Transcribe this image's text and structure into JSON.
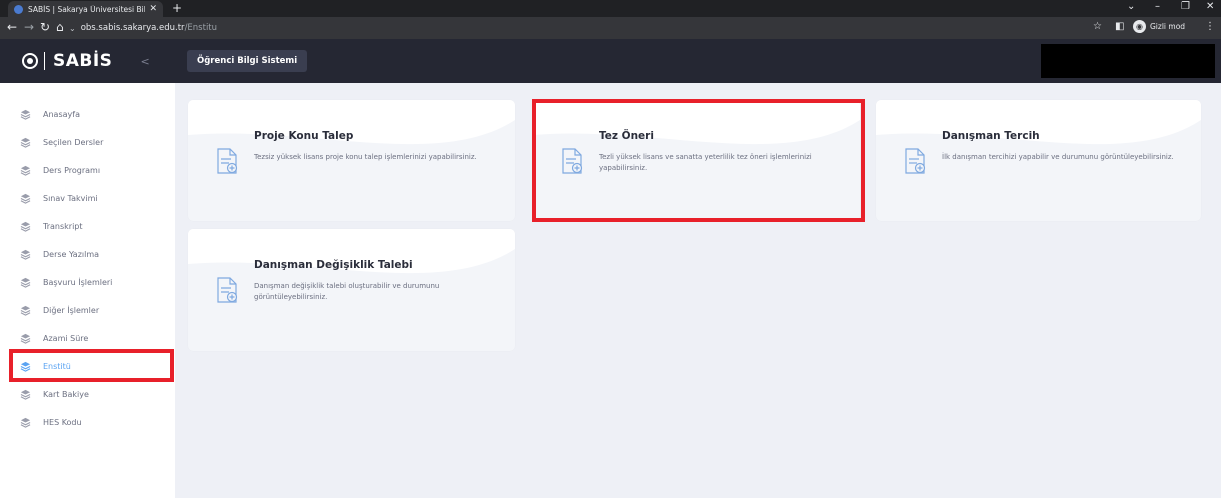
{
  "browser": {
    "tab_title": "SABİS | Sakarya Üniversitesi Bilgi",
    "url_host": "obs.sabis.sakarya.edu.tr",
    "url_path": "/Enstitu",
    "incognito_label": "Gizli mod"
  },
  "header": {
    "brand": "SABİS",
    "system_button": "Öğrenci Bilgi Sistemi"
  },
  "sidebar": {
    "items": [
      {
        "label": "Anasayfa",
        "active": false
      },
      {
        "label": "Seçilen Dersler",
        "active": false
      },
      {
        "label": "Ders Programı",
        "active": false
      },
      {
        "label": "Sınav Takvimi",
        "active": false
      },
      {
        "label": "Transkript",
        "active": false
      },
      {
        "label": "Derse Yazılma",
        "active": false
      },
      {
        "label": "Başvuru İşlemleri",
        "active": false
      },
      {
        "label": "Diğer İşlemler",
        "active": false
      },
      {
        "label": "Azami Süre",
        "active": false
      },
      {
        "label": "Enstitü",
        "active": true
      },
      {
        "label": "Kart Bakiye",
        "active": false
      },
      {
        "label": "HES Kodu",
        "active": false
      }
    ]
  },
  "cards": [
    {
      "title": "Proje Konu Talep",
      "description": "Tezsiz yüksek lisans proje konu talep işlemlerinizi yapabilirsiniz."
    },
    {
      "title": "Tez Öneri",
      "description": "Tezli yüksek lisans ve sanatta yeterlilik tez öneri işlemlerinizi yapabilirsiniz."
    },
    {
      "title": "Danışman Tercih",
      "description": "İlk danışman tercihizi yapabilir ve durumunu görüntüleyebilirsiniz."
    },
    {
      "title": "Danışman Değişiklik Talebi",
      "description": "Danışman değişiklik talebi oluşturabilir ve durumunu görüntüleyebilirsiniz."
    }
  ],
  "colors": {
    "accent": "#5aa3f2",
    "highlight": "#e8202a",
    "header_bg": "#252733"
  }
}
